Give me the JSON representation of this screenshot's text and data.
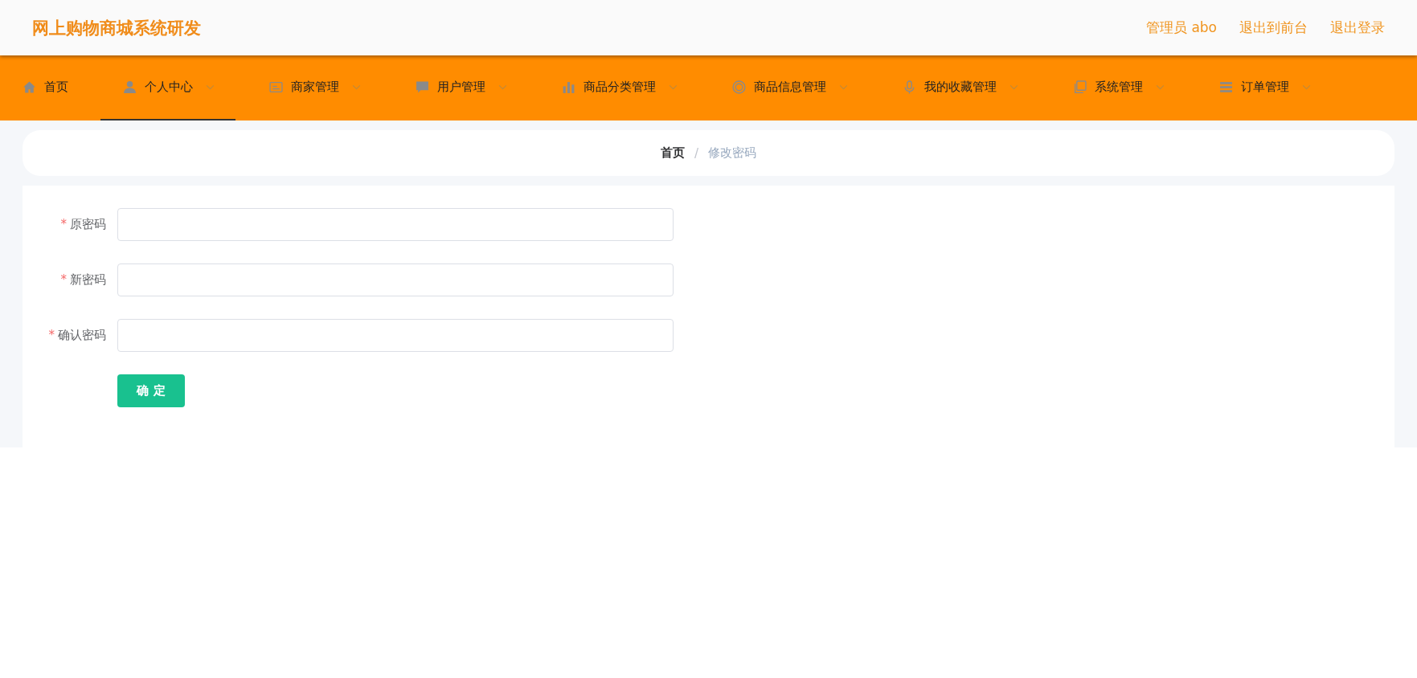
{
  "header": {
    "title": "网上购物商城系统研发",
    "links": [
      "管理员 abo",
      "退出到前台",
      "退出登录"
    ]
  },
  "nav": [
    {
      "label": "首页",
      "selected": false,
      "dropdown": false
    },
    {
      "label": "个人中心",
      "selected": true,
      "dropdown": true
    },
    {
      "label": "商家管理",
      "selected": false,
      "dropdown": true
    },
    {
      "label": "用户管理",
      "selected": false,
      "dropdown": true
    },
    {
      "label": "商品分类管理",
      "selected": false,
      "dropdown": true
    },
    {
      "label": "商品信息管理",
      "selected": false,
      "dropdown": true
    },
    {
      "label": "我的收藏管理",
      "selected": false,
      "dropdown": true
    },
    {
      "label": "系统管理",
      "selected": false,
      "dropdown": true
    },
    {
      "label": "订单管理",
      "selected": false,
      "dropdown": true
    }
  ],
  "breadcrumb": {
    "items": [
      "首页",
      "修改密码"
    ],
    "separator": "/"
  },
  "form": {
    "fields": [
      {
        "label": "原密码",
        "required_mark": "*"
      },
      {
        "label": "新密码",
        "required_mark": "*"
      },
      {
        "label": "确认密码",
        "required_mark": "*"
      }
    ],
    "submit": "确 定"
  }
}
